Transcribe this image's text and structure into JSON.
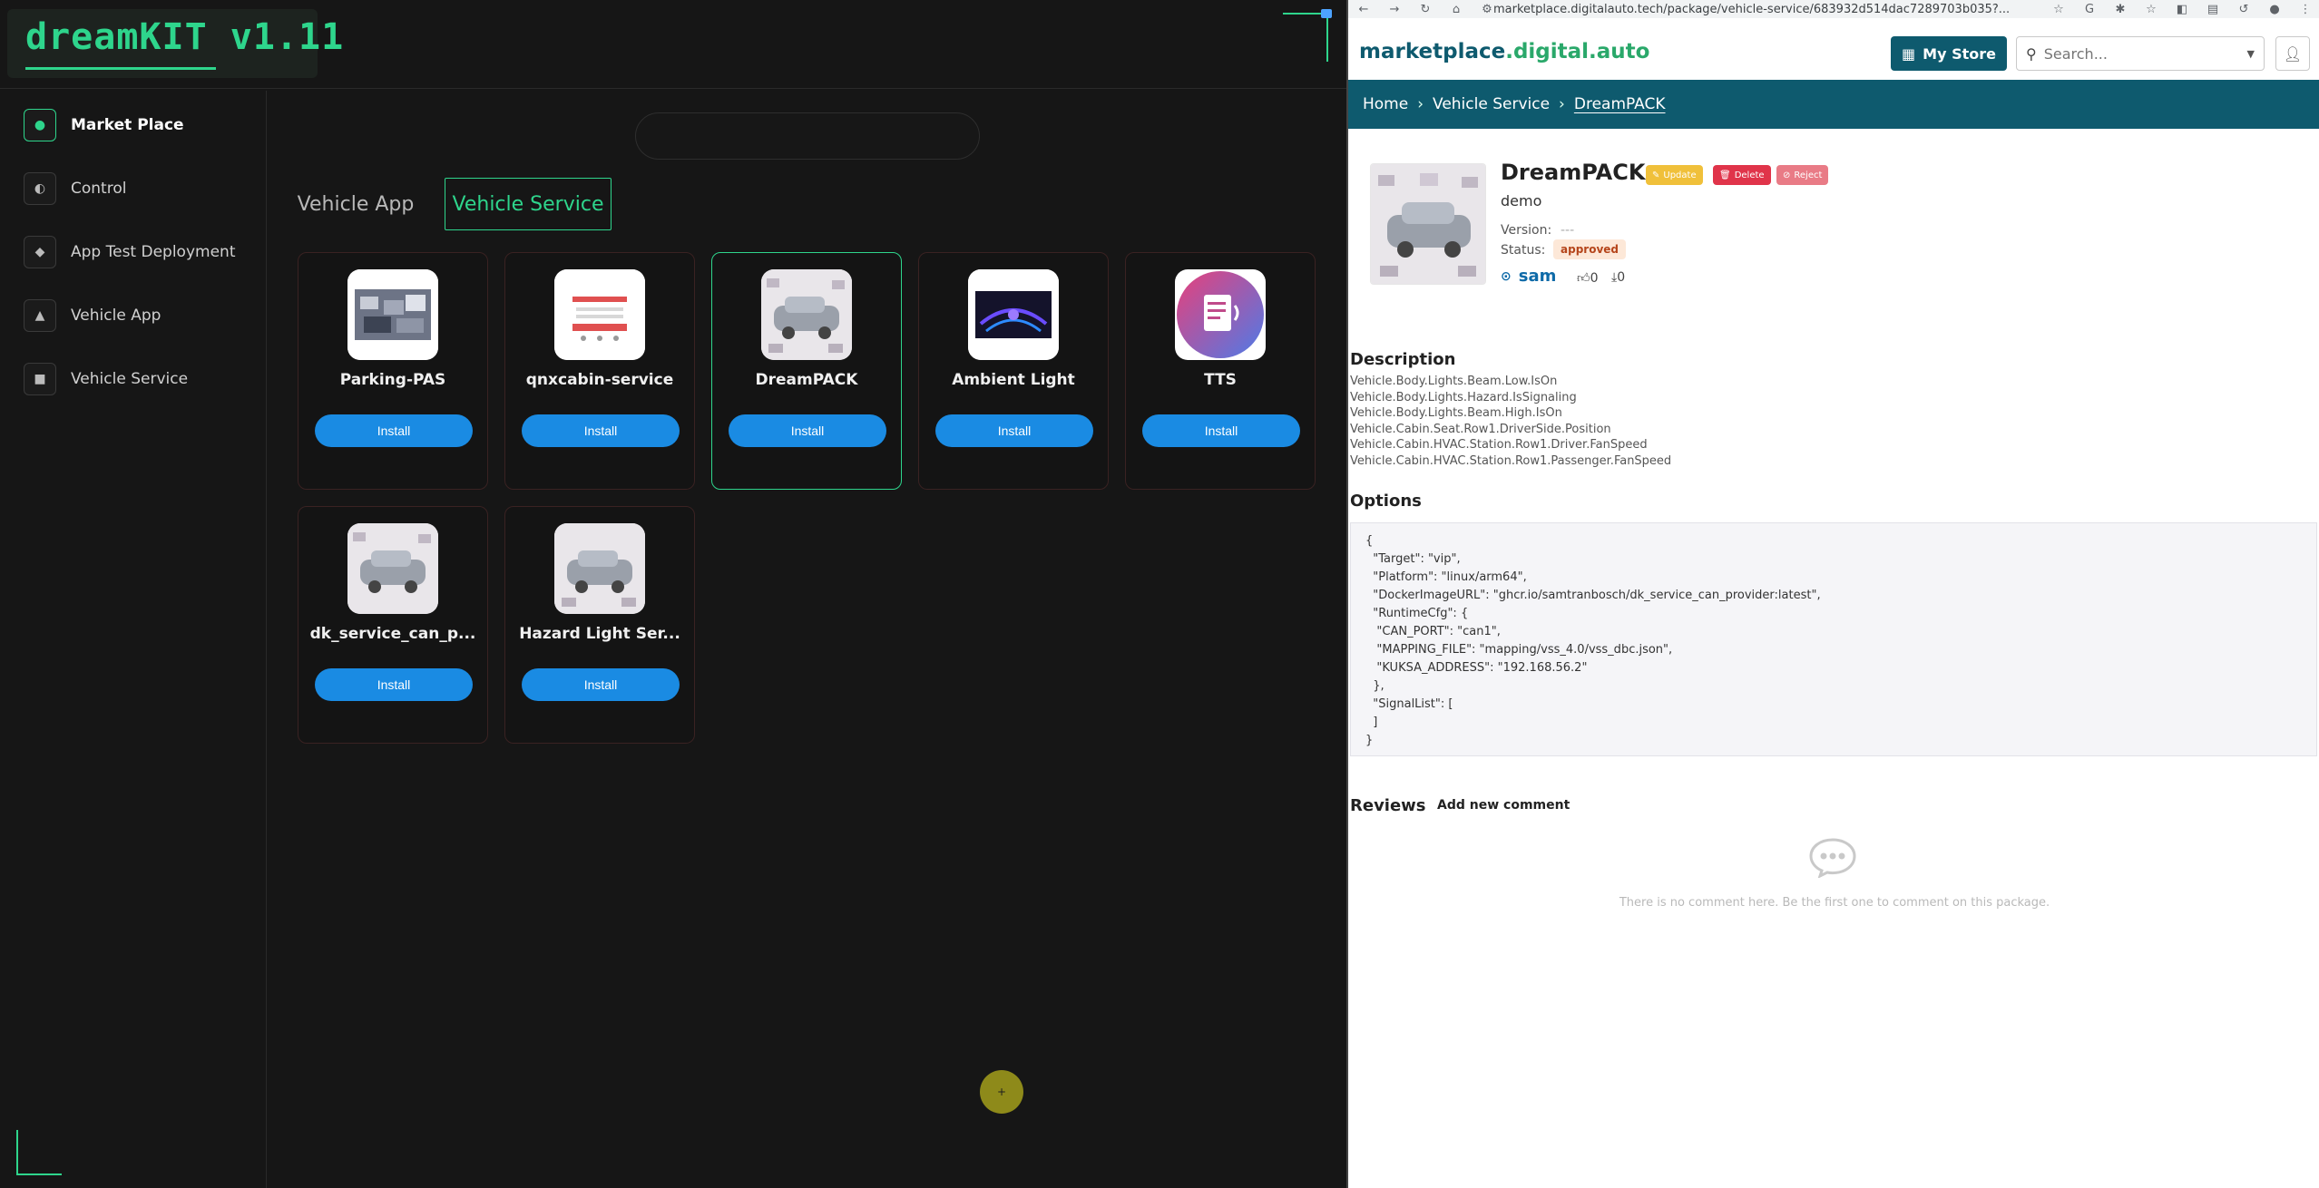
{
  "app": {
    "title": "dreamKIT v1.11"
  },
  "sidebar": {
    "items": [
      {
        "label": "Market Place",
        "icon": "dot-icon"
      },
      {
        "label": "Control",
        "icon": "half-circle-icon"
      },
      {
        "label": "App Test Deployment",
        "icon": "diamond-icon"
      },
      {
        "label": "Vehicle App",
        "icon": "triangle-icon"
      },
      {
        "label": "Vehicle Service",
        "icon": "square-icon"
      }
    ]
  },
  "tabs": {
    "vehicle_app": "Vehicle App",
    "vehicle_service": "Vehicle Service"
  },
  "cards": [
    {
      "name": "Parking-PAS",
      "install": "Install"
    },
    {
      "name": "qnxcabin-service",
      "install": "Install"
    },
    {
      "name": "DreamPACK",
      "install": "Install"
    },
    {
      "name": "Ambient Light",
      "install": "Install"
    },
    {
      "name": "TTS",
      "install": "Install"
    },
    {
      "name": "dk_service_can_p...",
      "install": "Install"
    },
    {
      "name": "Hazard Light Ser...",
      "install": "Install"
    }
  ],
  "browser": {
    "url": "marketplace.digitalauto.tech/package/vehicle-service/683932d514dac7289703b035?...",
    "site_logo_main": "marketplace",
    "site_logo_rest": ".digital.auto",
    "my_store": "My Store",
    "search_placeholder": "Search...",
    "breadcrumb": {
      "home": "Home",
      "category": "Vehicle Service",
      "current": "DreamPACK"
    },
    "package": {
      "name": "DreamPACK",
      "update": "Update",
      "delete": "Delete",
      "reject": "Reject",
      "summary": "demo",
      "version_label": "Version:",
      "version_value": "---",
      "status_label": "Status:",
      "status_value": "approved",
      "author": "sam",
      "likes": "0",
      "downloads": "0"
    },
    "description_title": "Description",
    "description_lines": [
      "Vehicle.Body.Lights.Beam.Low.IsOn",
      "Vehicle.Body.Lights.Hazard.IsSignaling",
      "Vehicle.Body.Lights.Beam.High.IsOn",
      "Vehicle.Cabin.Seat.Row1.DriverSide.Position",
      "Vehicle.Cabin.HVAC.Station.Row1.Driver.FanSpeed",
      "Vehicle.Cabin.HVAC.Station.Row1.Passenger.FanSpeed"
    ],
    "options_title": "Options",
    "options_json": "{\n  \"Target\": \"vip\",\n  \"Platform\": \"linux/arm64\",\n  \"DockerImageURL\": \"ghcr.io/samtranbosch/dk_service_can_provider:latest\",\n  \"RuntimeCfg\": {\n   \"CAN_PORT\": \"can1\",\n   \"MAPPING_FILE\": \"mapping/vss_4.0/vss_dbc.json\",\n   \"KUKSA_ADDRESS\": \"192.168.56.2\"\n  },\n  \"SignalList\": [\n  ]\n}",
    "reviews_title": "Reviews",
    "add_comment": "Add new comment",
    "no_comment": "There is no comment here. Be the first one to comment on this package."
  },
  "colors": {
    "accent": "#2ed58c",
    "install_button": "#1a8be3",
    "site_primary": "#0e5a6e"
  }
}
